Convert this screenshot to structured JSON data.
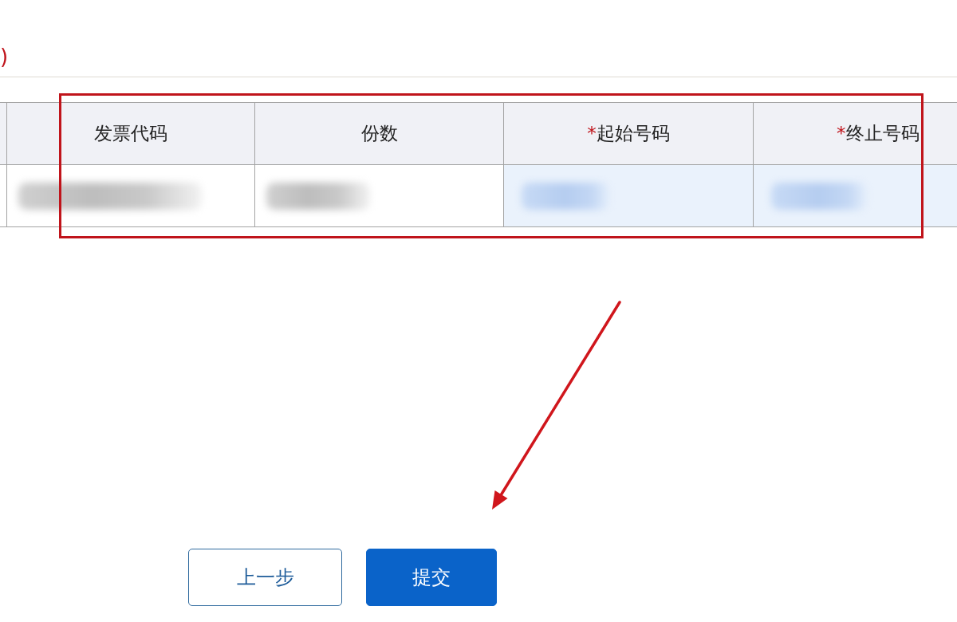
{
  "note": {
    "text": ")"
  },
  "table": {
    "highlighted": true,
    "columns": [
      {
        "label": "发票代码"
      },
      {
        "label": "份数"
      },
      {
        "label": "起始号码",
        "mark": "*"
      },
      {
        "label": "终止号码",
        "mark": "*"
      }
    ],
    "rows": [
      {
        "cells": [
          {
            "kind": "text"
          },
          {
            "kind": "text"
          },
          {
            "kind": "input"
          },
          {
            "kind": "input"
          }
        ]
      }
    ]
  },
  "buttons": [
    {
      "label": "上一步",
      "kind": "secondary",
      "pointed": false
    },
    {
      "label": "提交",
      "kind": "primary",
      "pointed": true
    }
  ]
}
